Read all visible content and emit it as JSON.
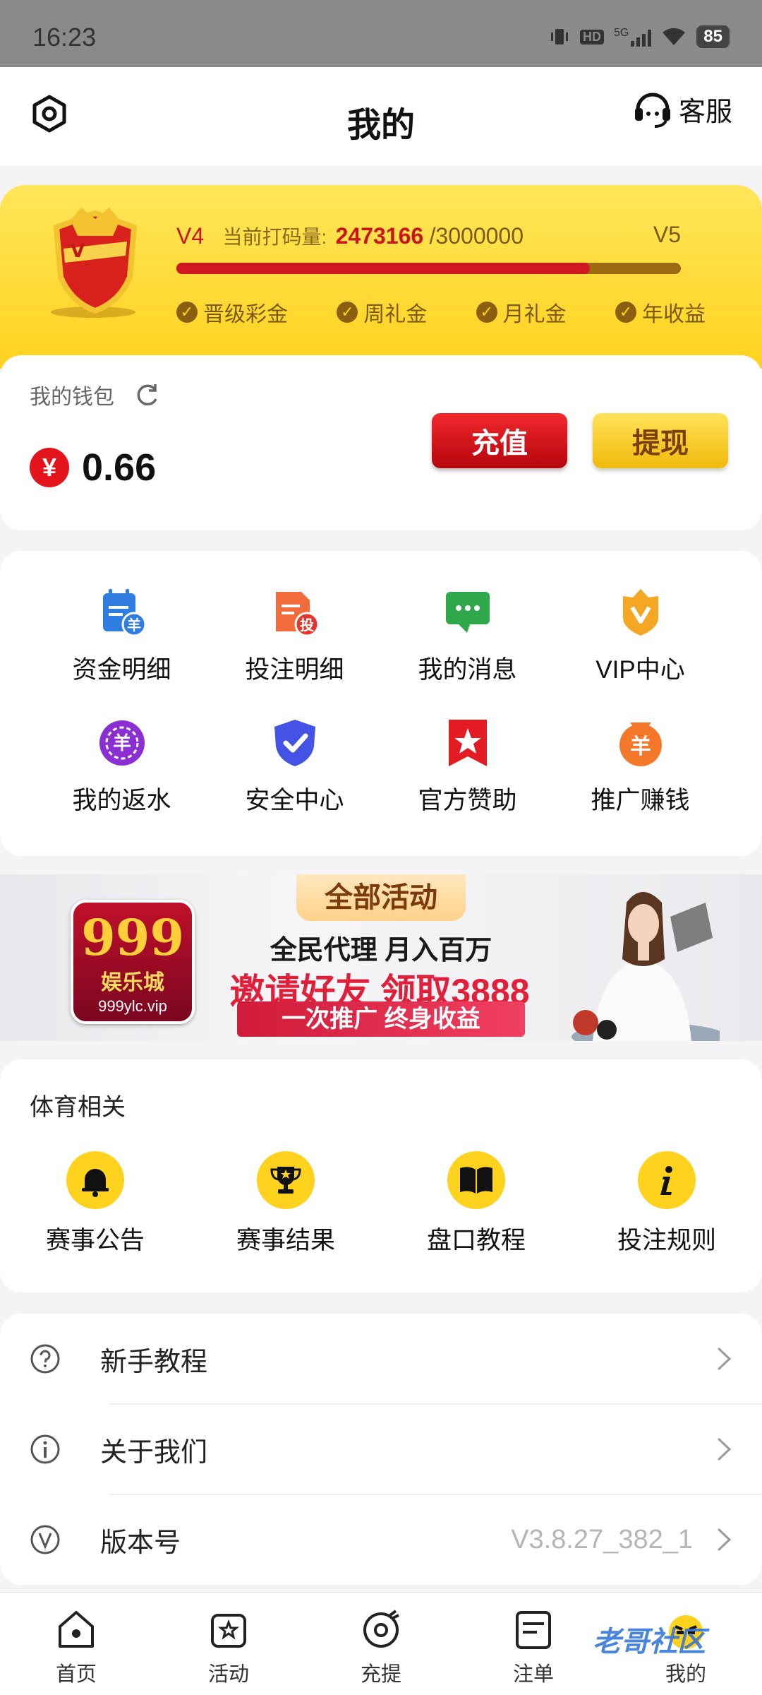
{
  "status_bar": {
    "time": "16:23",
    "network": "5G",
    "hd": "HD",
    "battery": "85"
  },
  "header": {
    "title": "我的",
    "service_label": "客服"
  },
  "vip": {
    "level_current": "V4",
    "progress_label": "当前打码量:",
    "current_value": "2473166",
    "target_value": "/3000000",
    "level_next": "V5",
    "progress_fraction": 0.82,
    "perks": [
      "晋级彩金",
      "周礼金",
      "月礼金",
      "年收益"
    ]
  },
  "wallet": {
    "label": "我的钱包",
    "currency_symbol": "¥",
    "balance": "0.66",
    "charge_label": "充值",
    "withdraw_label": "提现"
  },
  "features": [
    {
      "label": "资金明细",
      "icon": "fund-detail-icon"
    },
    {
      "label": "投注明细",
      "icon": "bet-detail-icon"
    },
    {
      "label": "我的消息",
      "icon": "message-icon"
    },
    {
      "label": "VIP中心",
      "icon": "vip-crown-icon"
    },
    {
      "label": "我的返水",
      "icon": "rebate-icon"
    },
    {
      "label": "安全中心",
      "icon": "shield-check-icon"
    },
    {
      "label": "官方赞助",
      "icon": "sponsor-star-icon"
    },
    {
      "label": "推广赚钱",
      "icon": "promo-money-icon"
    }
  ],
  "banner": {
    "tag": "全部活动",
    "line1": "全民代理 月入百万",
    "line2": "邀请好友 领取3888",
    "line3": "一次推广 终身收益",
    "logo_number": "999",
    "logo_name": "娱乐城",
    "logo_url": "999ylc.vip"
  },
  "sports": {
    "title": "体育相关",
    "items": [
      {
        "label": "赛事公告",
        "icon": "bell-icon"
      },
      {
        "label": "赛事结果",
        "icon": "trophy-icon"
      },
      {
        "label": "盘口教程",
        "icon": "book-icon"
      },
      {
        "label": "投注规则",
        "icon": "info-icon"
      }
    ]
  },
  "menu": [
    {
      "label": "新手教程",
      "value": "",
      "icon": "question-icon"
    },
    {
      "label": "关于我们",
      "value": "",
      "icon": "about-icon"
    },
    {
      "label": "版本号",
      "value": "V3.8.27_382_1",
      "icon": "version-icon"
    }
  ],
  "tabs": [
    {
      "label": "首页",
      "icon": "home-icon"
    },
    {
      "label": "活动",
      "icon": "activity-icon"
    },
    {
      "label": "充提",
      "icon": "deposit-icon"
    },
    {
      "label": "注单",
      "icon": "orders-icon"
    },
    {
      "label": "我的",
      "icon": "profile-icon"
    }
  ],
  "watermark": "老哥社区",
  "colors": {
    "accent_red": "#d0181f",
    "accent_yellow": "#ffd21e",
    "vip_brown": "#7a5a10"
  }
}
